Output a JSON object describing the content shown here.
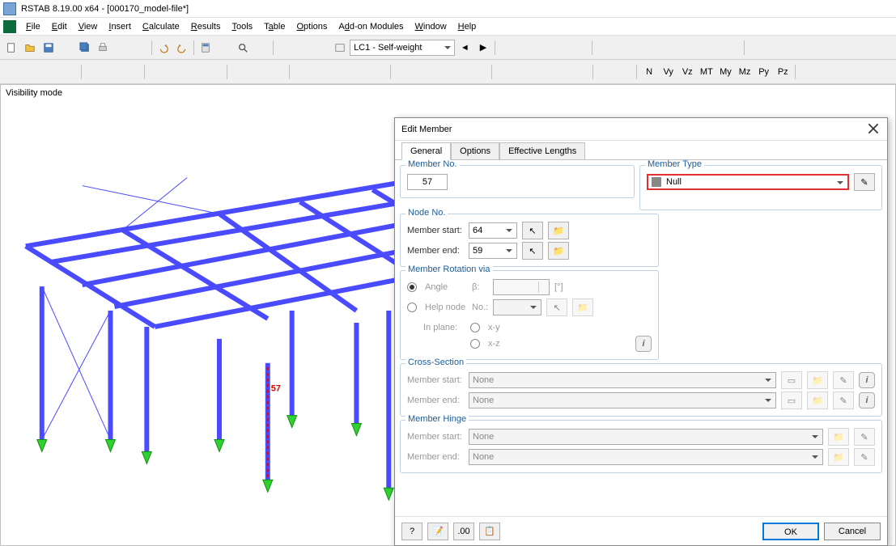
{
  "app": {
    "title": "RSTAB 8.19.00 x64 - [000170_model-file*]"
  },
  "menu": {
    "file": "File",
    "edit": "Edit",
    "view": "View",
    "insert": "Insert",
    "calculate": "Calculate",
    "results": "Results",
    "tools": "Tools",
    "table": "Table",
    "options": "Options",
    "addon": "Add-on Modules",
    "window": "Window",
    "help": "Help"
  },
  "toolbar": {
    "loadcase": "LC1 - Self-weight"
  },
  "viewport": {
    "mode": "Visibility mode",
    "member_label": "57"
  },
  "dialog": {
    "title": "Edit Member",
    "tabs": {
      "general": "General",
      "options": "Options",
      "eff": "Effective Lengths"
    },
    "memberno": {
      "label": "Member No.",
      "value": "57"
    },
    "membertype": {
      "label": "Member Type",
      "value": "Null"
    },
    "nodeno": {
      "label": "Node No.",
      "start_label": "Member start:",
      "start_value": "64",
      "end_label": "Member end:",
      "end_value": "59"
    },
    "rotation": {
      "label": "Member Rotation via",
      "angle": "Angle",
      "beta": "β:",
      "betaunit": "[°]",
      "helpnode": "Help node",
      "no": "No.:",
      "inplane": "In plane:",
      "xy": "x-y",
      "xz": "x-z"
    },
    "cross": {
      "label": "Cross-Section",
      "start": "Member start:",
      "end": "Member end:",
      "none": "None"
    },
    "hinge": {
      "label": "Member Hinge",
      "start": "Member start:",
      "end": "Member end:",
      "none": "None"
    },
    "ok": "OK",
    "cancel": "Cancel"
  }
}
